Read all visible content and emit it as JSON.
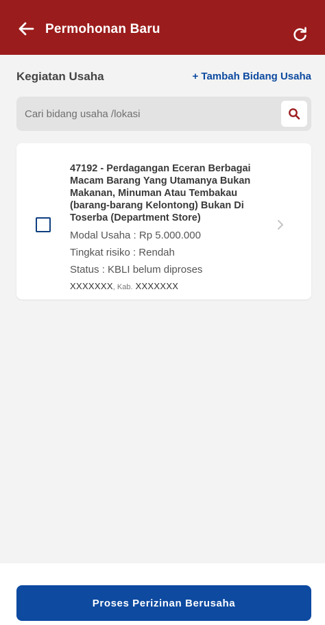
{
  "header": {
    "title": "Permohonan Baru",
    "back_icon": "arrow-left-icon",
    "refresh_icon": "refresh-icon",
    "background_color": "#9b1c1c"
  },
  "section": {
    "title": "Kegiatan Usaha",
    "add_link": "+ Tambah Bidang Usaha"
  },
  "search": {
    "placeholder": "Cari bidang usaha /lokasi",
    "value": "",
    "icon": "search-icon"
  },
  "items": [
    {
      "checked": false,
      "title": "47192 - Perdagangan Eceran Berbagai Macam Barang Yang Utamanya Bukan Makanan, Minuman Atau Tembakau (barang-barang Kelontong) Bukan Di Toserba (Department Store)",
      "modal": "Modal Usaha : Rp 5.000.000",
      "risk": "Tingkat risiko : Rendah",
      "status": "Status : KBLI belum diproses",
      "location_a": "XXXXXXX",
      "location_sep": ", Kab.",
      "location_b": "XXXXXXX"
    }
  ],
  "footer": {
    "primary_button": "Proses Perizinan Berusaha",
    "button_color": "#0d4aa0"
  }
}
